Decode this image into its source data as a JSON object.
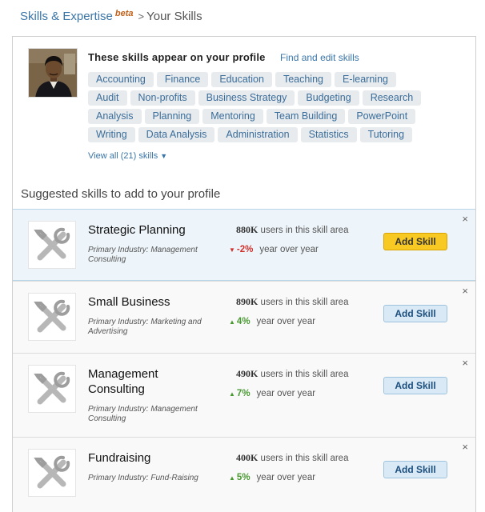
{
  "breadcrumb": {
    "root": "Skills & Expertise",
    "badge": "beta",
    "separator": ">",
    "current": "Your Skills"
  },
  "profile": {
    "title": "These skills appear on your profile",
    "edit_link": "Find and edit skills",
    "tag_rows": [
      [
        "Accounting",
        "Finance",
        "Education",
        "Teaching",
        "E-learning"
      ],
      [
        "Audit",
        "Non-profits",
        "Business Strategy",
        "Budgeting",
        "Research"
      ],
      [
        "Analysis",
        "Planning",
        "Mentoring",
        "Team Building",
        "PowerPoint"
      ],
      [
        "Writing",
        "Data Analysis",
        "Administration",
        "Statistics",
        "Tutoring"
      ]
    ],
    "view_all": "View all (21) skills"
  },
  "suggested": {
    "heading": "Suggested skills to add to your profile",
    "users_suffix": "users in this skill area",
    "yoy_suffix": "year over year",
    "items": [
      {
        "name": "Strategic Planning",
        "industry": "Primary Industry: Management Consulting",
        "users": "880K",
        "change": "-2%",
        "direction": "down",
        "button": "Add Skill",
        "close": "×"
      },
      {
        "name": "Small Business",
        "industry": "Primary Industry: Marketing and Advertising",
        "users": "890K",
        "change": "4%",
        "direction": "up",
        "button": "Add Skill",
        "close": "×"
      },
      {
        "name": "Management Consulting",
        "industry": "Primary Industry: Management Consulting",
        "users": "490K",
        "change": "7%",
        "direction": "up",
        "button": "Add Skill",
        "close": "×"
      },
      {
        "name": "Fundraising",
        "industry": "Primary Industry: Fund-Raising",
        "users": "400K",
        "change": "5%",
        "direction": "up",
        "button": "Add Skill",
        "close": "×"
      }
    ]
  },
  "colors": {
    "link": "#3a75a8",
    "highlight_row": "#eef5fa",
    "primary_button": "#f8c823",
    "secondary_button": "#d9eaf6",
    "trend_up": "#4a9a32",
    "trend_down": "#d0312d"
  },
  "icons": {
    "suggestion": "tools-icon",
    "view_all_caret": "caret-down-icon",
    "trend_up": "triangle-up-icon",
    "trend_down": "triangle-down-icon",
    "dismiss": "close-icon"
  }
}
